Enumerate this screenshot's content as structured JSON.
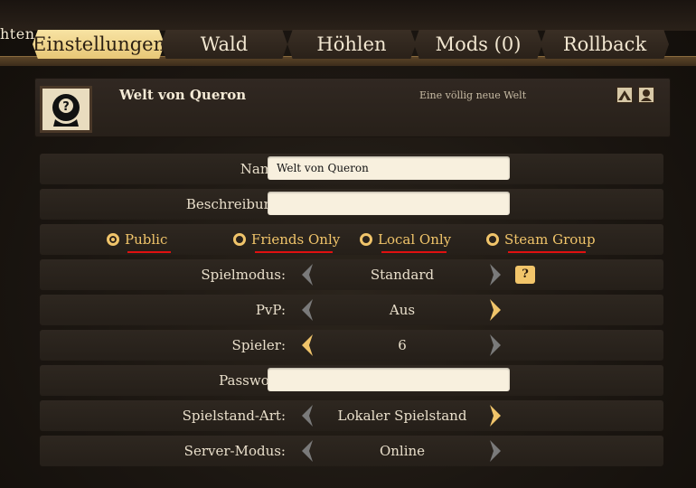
{
  "tabs": {
    "partial": "hten",
    "items": [
      {
        "label": "Einstellungen"
      },
      {
        "label": "Wald"
      },
      {
        "label": "Höhlen"
      },
      {
        "label": "Mods (0)"
      },
      {
        "label": "Rollback"
      }
    ]
  },
  "world": {
    "name": "Welt von Queron",
    "description": "Eine völlig neue Welt"
  },
  "form": {
    "name_label": "Name:",
    "name_value": "Welt von Queron",
    "description_label": "Beschreibung:",
    "description_value": "",
    "visibility": {
      "options": [
        "Public",
        "Friends Only",
        "Local Only",
        "Steam Group"
      ],
      "selected": "Public"
    },
    "game_mode": {
      "label": "Spielmodus:",
      "value": "Standard"
    },
    "pvp": {
      "label": "PvP:",
      "value": "Aus"
    },
    "players": {
      "label": "Spieler:",
      "value": "6"
    },
    "password": {
      "label": "Passwort:",
      "value": ""
    },
    "save_type": {
      "label": "Spielstand-Art:",
      "value": "Lokaler Spielstand"
    },
    "server_mode": {
      "label": "Server-Modus:",
      "value": "Online"
    }
  },
  "icons": {
    "help": "help-icon",
    "game_mode_help_glyph": "?"
  },
  "colors": {
    "accent": "#f0c46a",
    "active_tab": "#f8e3a3",
    "annotation_underline": "#e01010"
  }
}
